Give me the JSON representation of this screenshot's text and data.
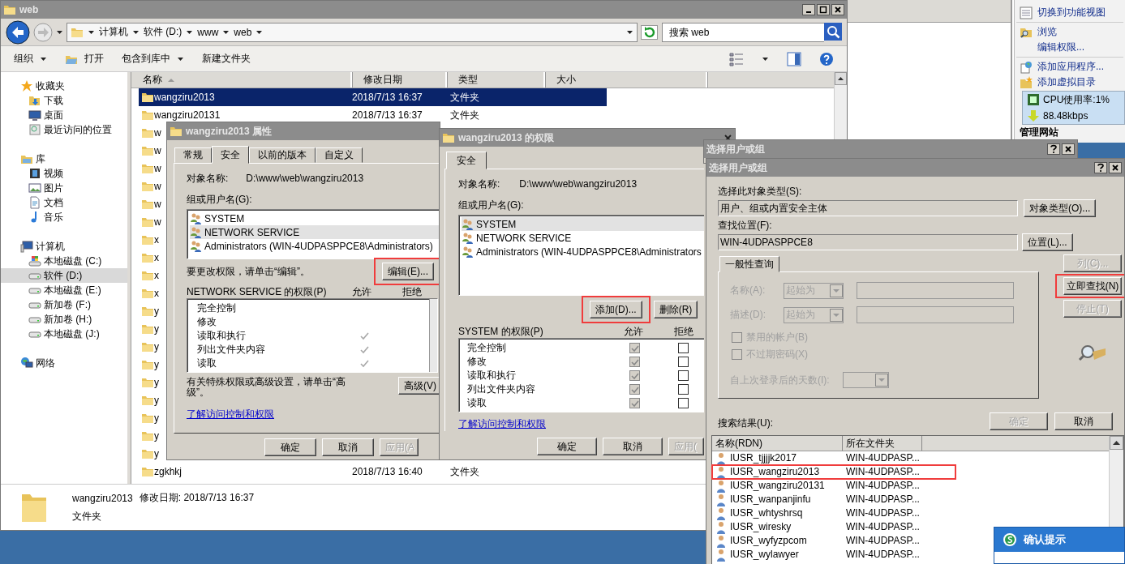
{
  "iis": {
    "actions": [
      {
        "label": "切换到功能视图",
        "kind": "view"
      },
      {
        "label": "浏览",
        "kind": "browse"
      },
      {
        "label": "编辑权限...",
        "kind": "plain"
      },
      {
        "label": "添加应用程序...",
        "kind": "app"
      },
      {
        "label": "添加虚拟目录",
        "kind": "vdir"
      }
    ],
    "section_title": "管理网站",
    "monitor": {
      "cpu": "CPU使用率:1%",
      "network": "88.48kbps"
    }
  },
  "explorer": {
    "title": "web",
    "path": [
      "计算机",
      "软件 (D:)",
      "www",
      "web"
    ],
    "search_placeholder": "搜索 web",
    "toolbar": [
      {
        "label": "组织",
        "dropdown": true,
        "kind": "plain"
      },
      {
        "label": "打开",
        "dropdown": false,
        "kind": "open"
      },
      {
        "label": "包含到库中",
        "dropdown": true,
        "kind": "plain"
      },
      {
        "label": "新建文件夹",
        "dropdown": false,
        "kind": "plain"
      }
    ],
    "nav": [
      {
        "label": "收藏夹",
        "kind": "star",
        "selected": false,
        "children": [
          {
            "label": "下载",
            "kind": "download",
            "selected": false
          },
          {
            "label": "桌面",
            "kind": "desktop",
            "selected": false
          },
          {
            "label": "最近访问的位置",
            "kind": "recent",
            "selected": false
          }
        ]
      },
      {
        "label": "库",
        "kind": "library",
        "selected": false,
        "children": [
          {
            "label": "视频",
            "kind": "video",
            "selected": false
          },
          {
            "label": "图片",
            "kind": "picture",
            "selected": false
          },
          {
            "label": "文档",
            "kind": "doc",
            "selected": false
          },
          {
            "label": "音乐",
            "kind": "music",
            "selected": false
          }
        ]
      },
      {
        "label": "计算机",
        "kind": "computer",
        "selected": false,
        "children": [
          {
            "label": "本地磁盘 (C:)",
            "kind": "sysdrive",
            "selected": false
          },
          {
            "label": "软件 (D:)",
            "kind": "drive",
            "selected": true
          },
          {
            "label": "本地磁盘 (E:)",
            "kind": "drive",
            "selected": false
          },
          {
            "label": "新加卷 (F:)",
            "kind": "drive",
            "selected": false
          },
          {
            "label": "新加卷 (H:)",
            "kind": "drive",
            "selected": false
          },
          {
            "label": "本地磁盘 (J:)",
            "kind": "drive",
            "selected": false
          }
        ]
      },
      {
        "label": "网络",
        "kind": "network",
        "selected": false
      }
    ],
    "columns": [
      {
        "label": "名称",
        "sorted": true
      },
      {
        "label": "修改日期",
        "sorted": false
      },
      {
        "label": "类型",
        "sorted": false
      },
      {
        "label": "大小",
        "sorted": false
      }
    ],
    "files": [
      {
        "name": "wangziru2013",
        "modified": "2018/7/13 16:37",
        "type": "文件夹",
        "selected": true
      },
      {
        "name": "wangziru20131",
        "modified": "2018/7/13 16:37",
        "type": "文件夹",
        "selected": false
      },
      {
        "name": "w",
        "selected": false
      },
      {
        "name": "w",
        "selected": false
      },
      {
        "name": "w",
        "selected": false
      },
      {
        "name": "w",
        "selected": false
      },
      {
        "name": "w",
        "selected": false
      },
      {
        "name": "w",
        "selected": false
      },
      {
        "name": "x",
        "selected": false
      },
      {
        "name": "x",
        "selected": false
      },
      {
        "name": "x",
        "selected": false
      },
      {
        "name": "x",
        "selected": false
      },
      {
        "name": "y",
        "selected": false
      },
      {
        "name": "y",
        "selected": false
      },
      {
        "name": "y",
        "selected": false
      },
      {
        "name": "y",
        "selected": false
      },
      {
        "name": "y",
        "selected": false
      },
      {
        "name": "y",
        "selected": false
      },
      {
        "name": "y",
        "selected": false
      },
      {
        "name": "y",
        "selected": false
      },
      {
        "name": "y",
        "selected": false
      },
      {
        "name": "zgkhkj",
        "modified": "2018/7/13 16:40",
        "type": "文件夹",
        "selected": false
      }
    ],
    "details": {
      "name": "wangziru2013",
      "modified": "修改日期: 2018/7/13 16:37",
      "type": "文件夹"
    }
  },
  "properties": {
    "title": "wangziru2013 属性",
    "tabs": [
      {
        "label": "常规",
        "selected": false
      },
      {
        "label": "安全",
        "selected": true
      },
      {
        "label": "以前的版本",
        "selected": false
      },
      {
        "label": "自定义",
        "selected": false
      }
    ],
    "object_label": "对象名称:",
    "object_path": "D:\\www\\web\\wangziru2013",
    "group_label": "组或用户名(G):",
    "principals": [
      {
        "name": "SYSTEM",
        "selected": false
      },
      {
        "name": "NETWORK SERVICE",
        "selected": true
      },
      {
        "name": "Administrators (WIN-4UDPASPPCE8\\Administrators)",
        "selected": false
      }
    ],
    "edit_hint": "要更改权限，请单击“编辑”。",
    "edit_button": {
      "label": "编辑(E)...",
      "highlighted": true
    },
    "perm_label": "NETWORK SERVICE 的权限(P)",
    "allow_label": "允许",
    "deny_label": "拒绝",
    "permissions": [
      {
        "name": "完全控制",
        "allow": false,
        "deny": false
      },
      {
        "name": "修改",
        "allow": false,
        "deny": false
      },
      {
        "name": "读取和执行",
        "allow": true,
        "deny": false
      },
      {
        "name": "列出文件夹内容",
        "allow": true,
        "deny": false
      },
      {
        "name": "读取",
        "allow": true,
        "deny": false
      }
    ],
    "advanced_hint": "有关特殊权限或高级设置，请单击“高级”。",
    "advanced_button": "高级(V)",
    "link": "了解访问控制和权限",
    "buttons": [
      {
        "label": "确定",
        "disabled": false
      },
      {
        "label": "取消",
        "disabled": false
      },
      {
        "label": "应用(A",
        "disabled": true
      }
    ]
  },
  "permissions_dialog": {
    "title": "wangziru2013 的权限",
    "tab": "安全",
    "object_label": "对象名称:",
    "object_path": "D:\\www\\web\\wangziru2013",
    "group_label": "组或用户名(G):",
    "principals": [
      {
        "name": "SYSTEM",
        "selected": true
      },
      {
        "name": "NETWORK SERVICE",
        "selected": false
      },
      {
        "name": "Administrators (WIN-4UDPASPPCE8\\Administrators",
        "selected": false
      }
    ],
    "add_button": {
      "label": "添加(D)...",
      "highlighted": true
    },
    "remove_button": "删除(R)",
    "perm_label": "SYSTEM 的权限(P)",
    "allow_label": "允许",
    "deny_label": "拒绝",
    "permissions": [
      {
        "name": "完全控制",
        "allow": true,
        "deny": false
      },
      {
        "name": "修改",
        "allow": true,
        "deny": false
      },
      {
        "name": "读取和执行",
        "allow": true,
        "deny": false
      },
      {
        "name": "列出文件夹内容",
        "allow": true,
        "deny": false
      },
      {
        "name": "读取",
        "allow": true,
        "deny": false
      }
    ],
    "link": "了解访问控制和权限",
    "buttons": [
      {
        "label": "确定",
        "disabled": false
      },
      {
        "label": "取消",
        "disabled": false
      },
      {
        "label": "应用(",
        "disabled": true
      }
    ]
  },
  "select_back": {
    "title": "选择用户或组"
  },
  "select_dialog": {
    "title": "选择用户或组",
    "object_type_label": "选择此对象类型(S):",
    "object_type": "用户、组或内置安全主体",
    "object_type_button": "对象类型(O)...",
    "location_label": "查找位置(F):",
    "location": "WIN-4UDPASPPCE8",
    "location_button": "位置(L)...",
    "query_tab": "一般性查询",
    "name_label": "名称(A):",
    "name_match": "起始为",
    "desc_label": "描述(D):",
    "desc_match": "起始为",
    "options": [
      {
        "label": "禁用的帐户(B)",
        "checked": false
      },
      {
        "label": "不过期密码(X)",
        "checked": false
      }
    ],
    "days_label": "自上次登录后的天数(I):",
    "side_buttons": [
      {
        "label": "列(C)...",
        "disabled": true,
        "highlighted": false
      },
      {
        "label": "立即查找(N)",
        "disabled": false,
        "highlighted": true
      },
      {
        "label": "停止(T)",
        "disabled": true,
        "highlighted": false
      }
    ],
    "buttons": [
      {
        "label": "确定",
        "disabled": true
      },
      {
        "label": "取消",
        "disabled": false
      }
    ],
    "results_label": "搜索结果(U):",
    "columns": [
      "名称(RDN)",
      "所在文件夹"
    ],
    "results": [
      {
        "name": "IUSR_tjjjjk2017",
        "folder": "WIN-4UDPASP...",
        "highlighted": false
      },
      {
        "name": "IUSR_wangziru2013",
        "folder": "WIN-4UDPASP...",
        "highlighted": true
      },
      {
        "name": "IUSR_wangziru20131",
        "folder": "WIN-4UDPASP...",
        "highlighted": false
      },
      {
        "name": "IUSR_wanpanjinfu",
        "folder": "WIN-4UDPASP...",
        "highlighted": false
      },
      {
        "name": "IUSR_whtyshrsq",
        "folder": "WIN-4UDPASP...",
        "highlighted": false
      },
      {
        "name": "IUSR_wiresky",
        "folder": "WIN-4UDPASP...",
        "highlighted": false
      },
      {
        "name": "IUSR_wyfyzpcom",
        "folder": "WIN-4UDPASP...",
        "highlighted": false
      },
      {
        "name": "IUSR_wylawyer",
        "folder": "WIN-4UDPASP...",
        "highlighted": false
      }
    ]
  },
  "confirm_popup": {
    "title": "确认提示"
  }
}
